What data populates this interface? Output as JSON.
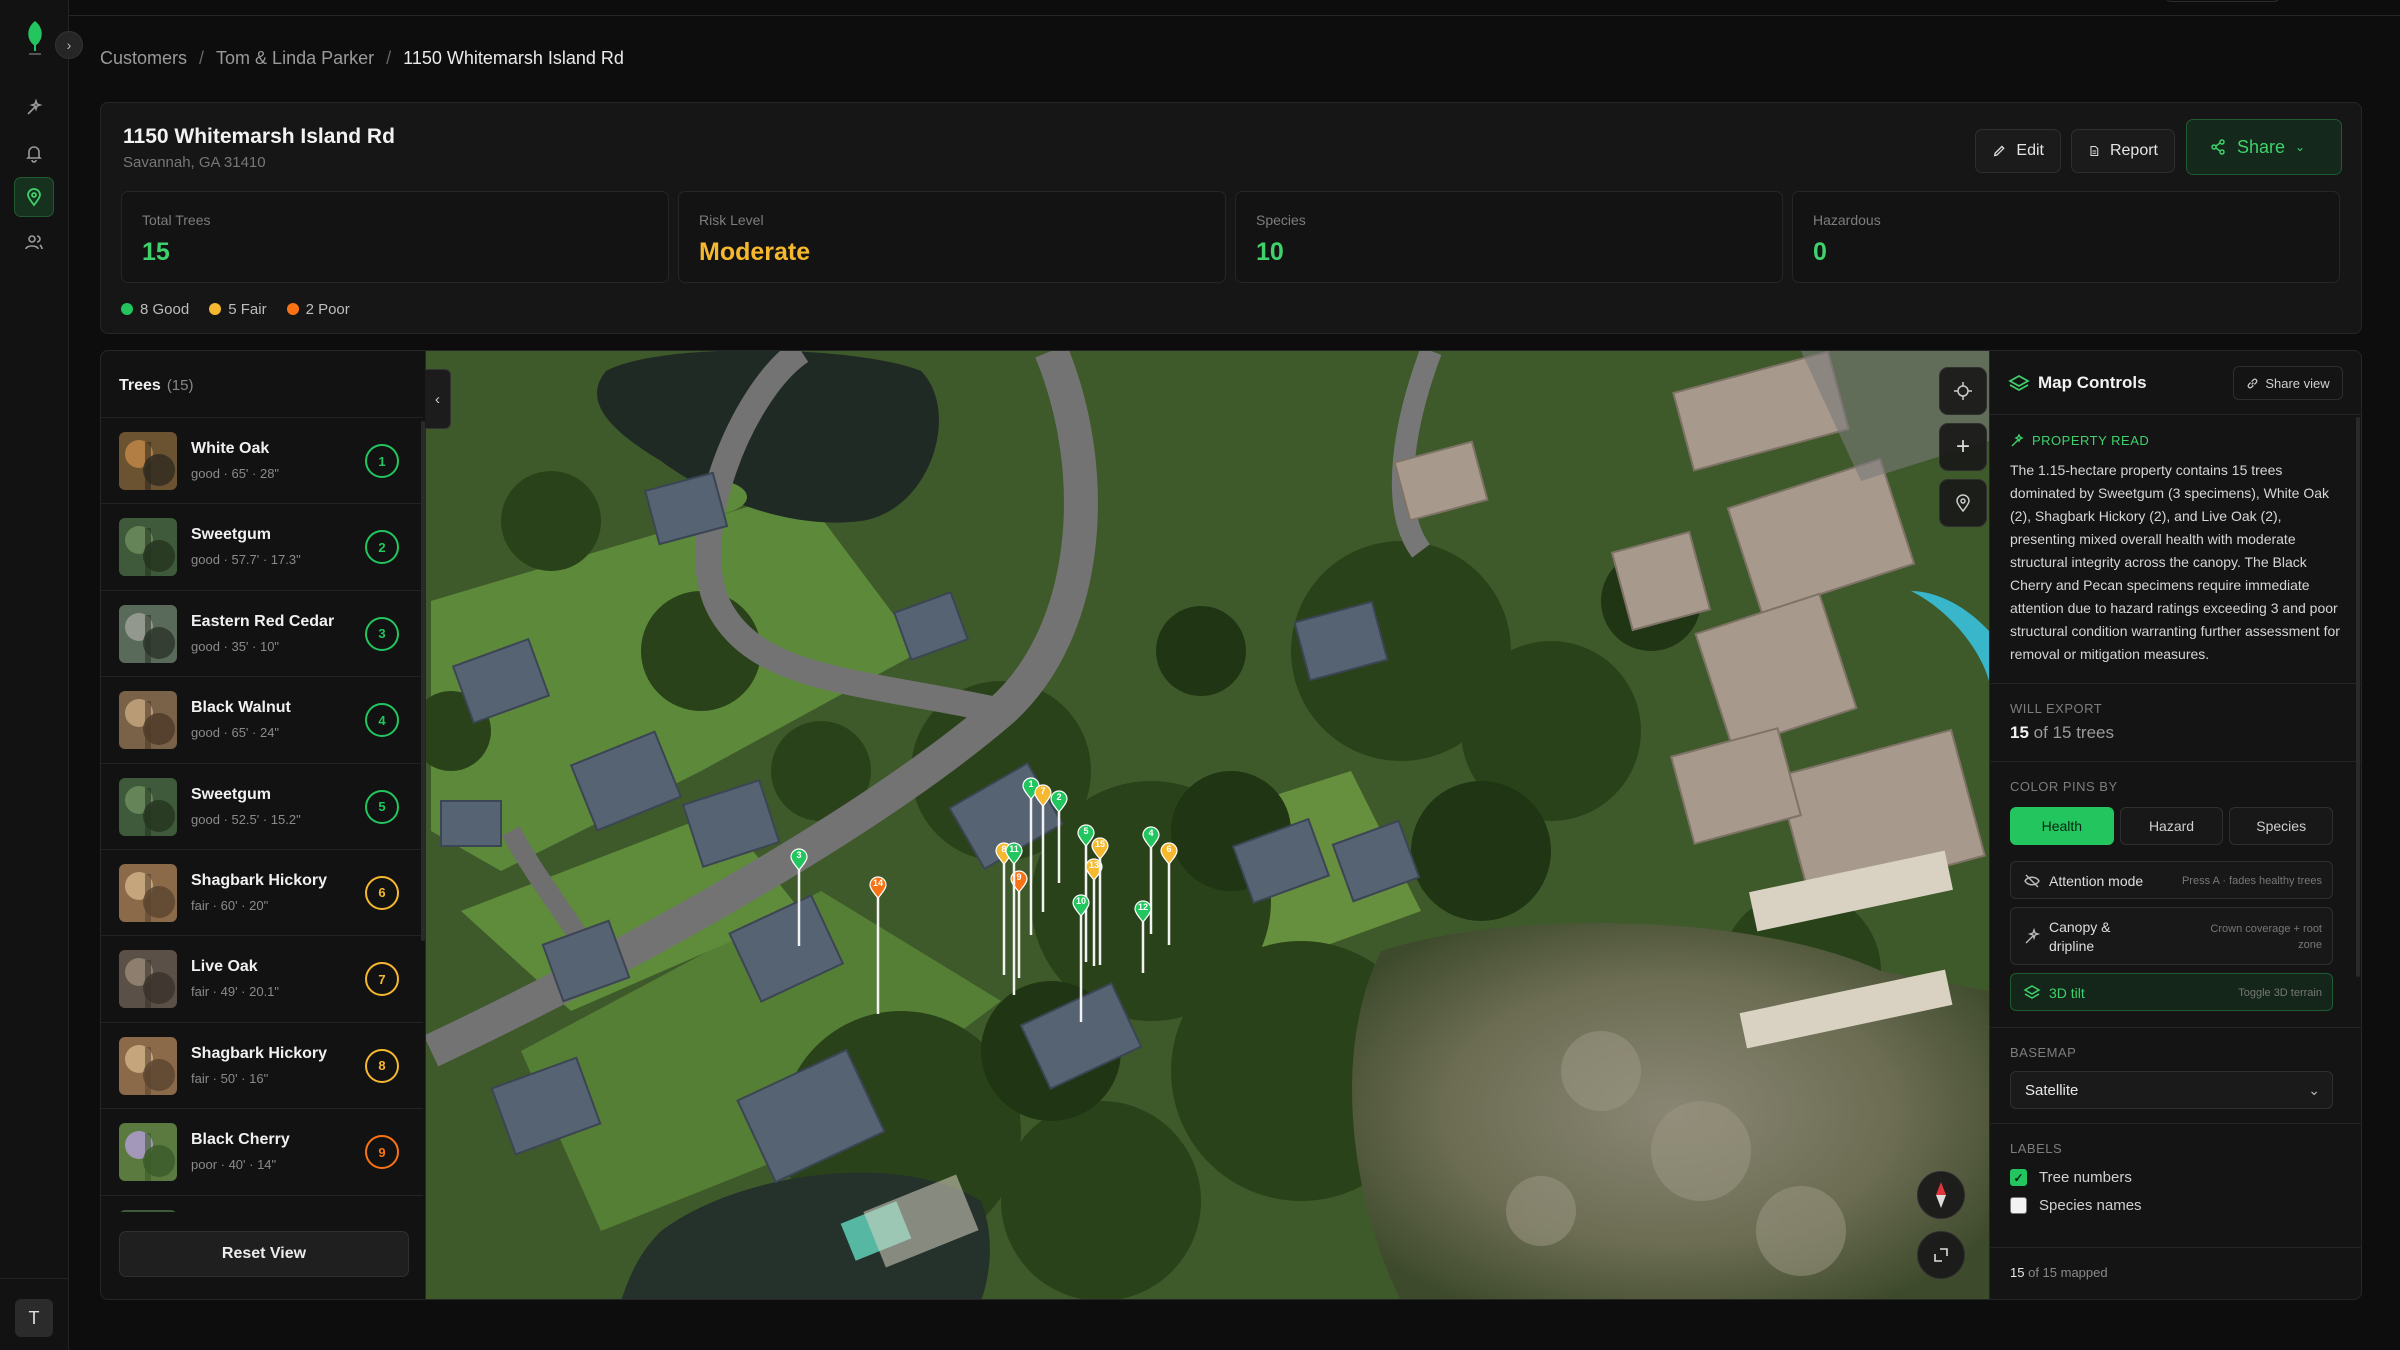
{
  "sidebar": {
    "avatar_initial": "T"
  },
  "breadcrumb": {
    "items": [
      "Customers",
      "Tom & Linda Parker",
      "1150 Whitemarsh Island Rd"
    ]
  },
  "header": {
    "title": "1150 Whitemarsh Island Rd",
    "subtitle": "Savannah, GA 31410",
    "edit_label": "Edit",
    "report_label": "Report",
    "share_label": "Share"
  },
  "stats": [
    {
      "label": "Total Trees",
      "value": "15",
      "color": "#3fd16b"
    },
    {
      "label": "Risk Level",
      "value": "Moderate",
      "color": "#f5b82e"
    },
    {
      "label": "Species",
      "value": "10",
      "color": "#3fd16b"
    },
    {
      "label": "Hazardous",
      "value": "0",
      "color": "#3fd16b"
    }
  ],
  "health_legend": [
    {
      "label": "8 Good",
      "color": "#22c55e"
    },
    {
      "label": "5 Fair",
      "color": "#f5b82e"
    },
    {
      "label": "2 Poor",
      "color": "#f97316"
    }
  ],
  "trees_panel": {
    "title": "Trees",
    "count": "(15)",
    "reset_label": "Reset View",
    "items": [
      {
        "name": "White Oak",
        "meta": "good · 65' · 28\"",
        "num": "1",
        "status": "good"
      },
      {
        "name": "Sweetgum",
        "meta": "good · 57.7' · 17.3\"",
        "num": "2",
        "status": "good"
      },
      {
        "name": "Eastern Red Cedar",
        "meta": "good · 35' · 10\"",
        "num": "3",
        "status": "good"
      },
      {
        "name": "Black Walnut",
        "meta": "good · 65' · 24\"",
        "num": "4",
        "status": "good"
      },
      {
        "name": "Sweetgum",
        "meta": "good · 52.5' · 15.2\"",
        "num": "5",
        "status": "good"
      },
      {
        "name": "Shagbark Hickory",
        "meta": "fair · 60' · 20\"",
        "num": "6",
        "status": "fair"
      },
      {
        "name": "Live Oak",
        "meta": "fair · 49' · 20.1\"",
        "num": "7",
        "status": "fair"
      },
      {
        "name": "Shagbark Hickory",
        "meta": "fair · 50' · 16\"",
        "num": "8",
        "status": "fair"
      },
      {
        "name": "Black Cherry",
        "meta": "poor · 40' · 14\"",
        "num": "9",
        "status": "poor"
      },
      {
        "name": "",
        "meta": "",
        "num": "",
        "status": "good"
      }
    ]
  },
  "status_colors": {
    "good": "#22c55e",
    "fair": "#f5b82e",
    "poor": "#f97316"
  },
  "map_pins": [
    {
      "num": "1",
      "status": "good"
    },
    {
      "num": "2",
      "status": "good"
    },
    {
      "num": "3",
      "status": "good"
    },
    {
      "num": "4",
      "status": "good"
    },
    {
      "num": "5",
      "status": "good"
    },
    {
      "num": "6",
      "status": "fair"
    },
    {
      "num": "7",
      "status": "fair"
    },
    {
      "num": "8",
      "status": "fair"
    },
    {
      "num": "9",
      "status": "poor"
    },
    {
      "num": "10",
      "status": "good"
    },
    {
      "num": "11",
      "status": "good"
    },
    {
      "num": "12",
      "status": "good"
    },
    {
      "num": "13",
      "status": "fair"
    },
    {
      "num": "14",
      "status": "poor"
    },
    {
      "num": "15",
      "status": "fair"
    }
  ],
  "controls": {
    "title": "Map Controls",
    "share_view": "Share view",
    "property_label": "PROPERTY READ",
    "property_text": "The 1.15-hectare property contains 15 trees dominated by Sweetgum (3 specimens), White Oak (2), Shagbark Hickory (2), and Live Oak (2), presenting mixed overall health with moderate structural integrity across the canopy. The Black Cherry and Pecan specimens require immediate attention due to hazard ratings exceeding 3 and poor structural condition warranting further assessment for removal or mitigation measures.",
    "export_label": "WILL EXPORT",
    "export_count": "15",
    "export_rest": "of 15 trees",
    "color_label": "COLOR PINS BY",
    "color_options": [
      "Health",
      "Hazard",
      "Species"
    ],
    "attention_label": "Attention mode",
    "attention_desc": "Press A · fades healthy trees",
    "canopy_label": "Canopy & dripline",
    "canopy_desc": "Crown coverage + root zone",
    "tilt_label": "3D tilt",
    "tilt_desc": "Toggle 3D terrain",
    "basemap_label": "BASEMAP",
    "basemap_value": "Satellite",
    "labels_label": "LABELS",
    "tree_numbers": "Tree numbers",
    "species_names": "Species names",
    "mapped_count": "15",
    "mapped_rest": "of 15 mapped"
  }
}
